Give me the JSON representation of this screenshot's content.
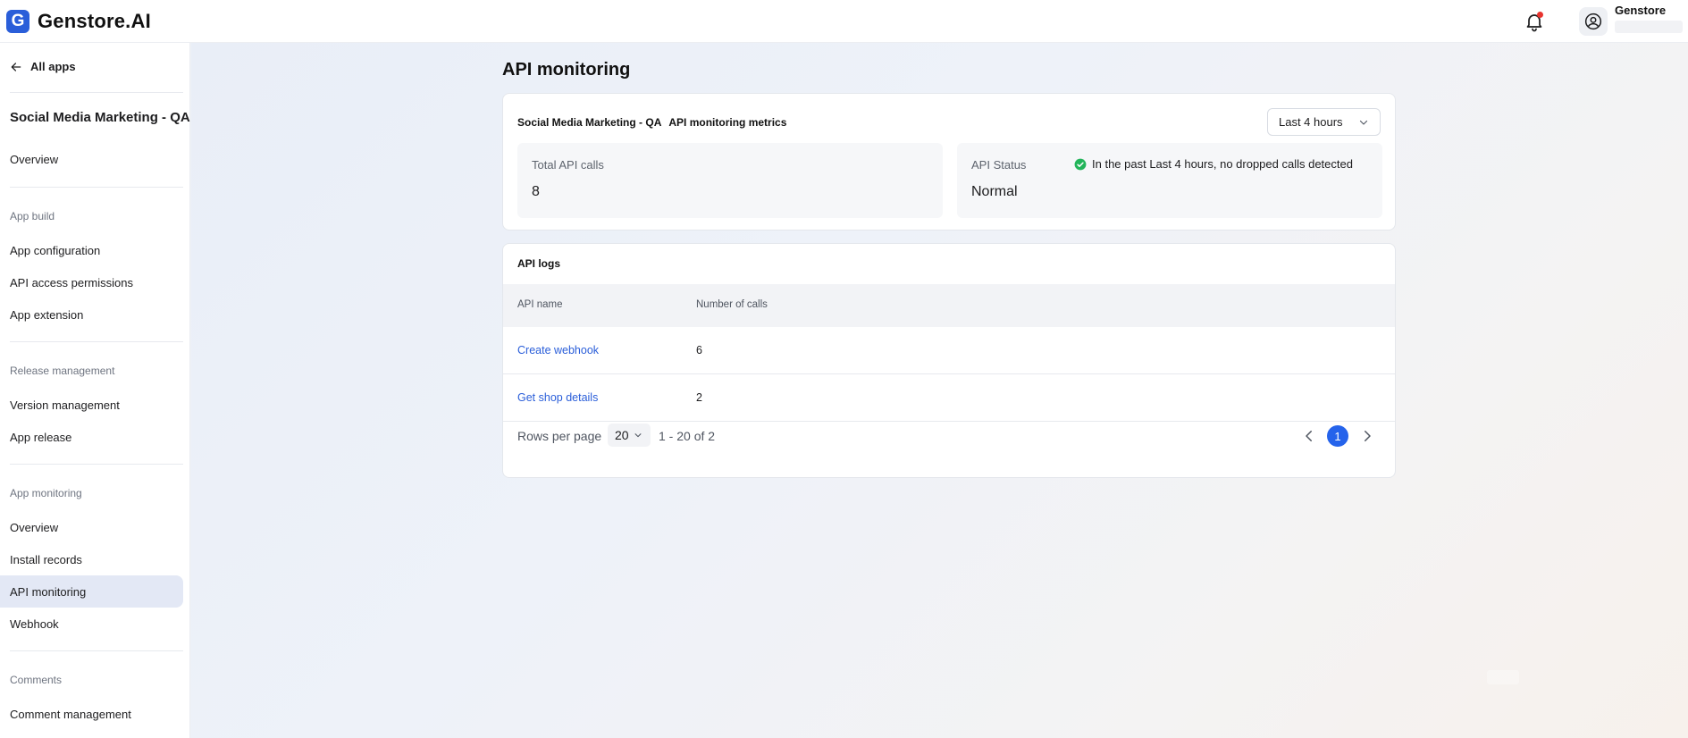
{
  "app": {
    "name": "Genstore.AI",
    "logo_letter": "G",
    "brand_color": "#2a5ed9"
  },
  "topbar": {
    "user_name": "Genstore",
    "notification_icon": "bell-icon",
    "has_notification_dot": true
  },
  "sidebar": {
    "back_label": "All apps",
    "app_title": "Social Media Marketing - QA",
    "overview_label": "Overview",
    "groups": {
      "app_build": {
        "label": "App build",
        "items": [
          "App configuration",
          "API access permissions",
          "App extension"
        ]
      },
      "release_management": {
        "label": "Release management",
        "items": [
          "Version management",
          "App release"
        ]
      },
      "app_monitoring": {
        "label": "App monitoring",
        "items": [
          "Overview",
          "Install records",
          "API monitoring",
          "Webhook"
        ]
      },
      "comments": {
        "label": "Comments",
        "items": [
          "Comment management"
        ]
      }
    },
    "active_item": "API monitoring"
  },
  "main": {
    "page_title": "API monitoring",
    "metrics": {
      "app_name": "Social Media Marketing - QA",
      "heading": "API monitoring metrics",
      "time_range": "Last 4 hours",
      "total_calls_label": "Total API calls",
      "total_calls_value": "8",
      "status_label": "API Status",
      "status_value": "Normal",
      "status_note": "In the past Last 4 hours, no dropped calls detected",
      "status_color": "#22b45a"
    },
    "logs": {
      "title": "API logs",
      "columns": [
        "API name",
        "Number of calls"
      ],
      "rows": [
        {
          "api_name": "Create webhook",
          "calls": "6"
        },
        {
          "api_name": "Get shop details",
          "calls": "2"
        }
      ],
      "rows_per_page_label": "Rows per page",
      "rows_per_page": "20",
      "range_text": "1 - 20 of 2",
      "current_page": "1"
    }
  }
}
